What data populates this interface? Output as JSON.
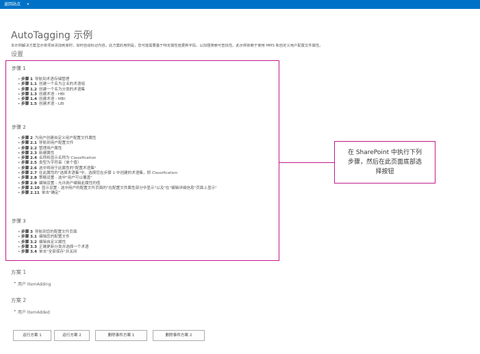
{
  "topbar": {
    "back_link": "返回站点",
    "caret": "▸"
  },
  "page": {
    "title": "AutoTagging 示例",
    "description": "本示例解决方案显示将项目添加到库时，如何自动标记内容。此方案的用例是，您可能需要基于特定属性值更新字段，以加强搜索可查找性。此示例依赖于使用 MMS 和自定义用户配置文件属性。",
    "settings_heading": "设置"
  },
  "steps": [
    {
      "title": "步骤 1",
      "items": [
        {
          "label": "步骤",
          "num": "1",
          "text": "导航到术语存储管理"
        },
        {
          "label": "步骤",
          "num": "1.1",
          "text": "创建一个名为企业的术语组"
        },
        {
          "label": "步骤",
          "num": "1.2",
          "text": "创建一个名为分类的术语集"
        },
        {
          "label": "步骤",
          "num": "1.3",
          "text": "创建术语 - HBI"
        },
        {
          "label": "步骤",
          "num": "1.4",
          "text": "创建术语 - MBI"
        },
        {
          "label": "步骤",
          "num": "1.5",
          "text": "创建术语 - LBI"
        }
      ]
    },
    {
      "title": "步骤 2",
      "items": [
        {
          "label": "步骤",
          "num": "2",
          "text": "为用户创建自定义用户配置文件属性"
        },
        {
          "label": "步骤",
          "num": "2.1",
          "text": "导航到用户配置文件"
        },
        {
          "label": "步骤",
          "num": "2.2",
          "text": "管理用户属性"
        },
        {
          "label": "步骤",
          "num": "2.3",
          "text": "新建属性"
        },
        {
          "label": "步骤",
          "num": "2.4",
          "text": "名称和显示名称为 Classification"
        },
        {
          "label": "步骤",
          "num": "2.5",
          "text": "类型为字符串（单个值）"
        },
        {
          "label": "步骤",
          "num": "2.6",
          "text": "选中将用于此属性的\"配置术语集\""
        },
        {
          "label": "步骤",
          "num": "2.7",
          "text": "在此属性的\"选择术语集\"中，选择您在步骤 1 中创建的术语集，即 Classification"
        },
        {
          "label": "步骤",
          "num": "2.8",
          "text": "策略设置 - 选中\"用户可以覆盖\""
        },
        {
          "label": "步骤",
          "num": "2.9",
          "text": "编辑设置 - 允许用户编辑此属性的值"
        },
        {
          "label": "步骤",
          "num": "2.10",
          "text": "显示设置 - 选中用户的配置文件页面的\"在配置文件属性部分中显示\"以及\"在\"编辑详细信息\"页面上显示\""
        },
        {
          "label": "步骤",
          "num": "2.11",
          "text": "单击\"确定\""
        }
      ]
    },
    {
      "title": "步骤 3",
      "items": [
        {
          "label": "步骤",
          "num": "3",
          "text": "导航到您的配置文件页面"
        },
        {
          "label": "步骤",
          "num": "3.1",
          "text": "编辑您的配置文件"
        },
        {
          "label": "步骤",
          "num": "3.2",
          "text": "编辑自定义属性"
        },
        {
          "label": "步骤",
          "num": "3.3",
          "text": "正确更新分类并选择一个术语"
        },
        {
          "label": "步骤",
          "num": "3.4",
          "text": "单击\"全部保存\"并关闭"
        }
      ]
    }
  ],
  "callout": {
    "text": "在 SharePoint 中执行下列步骤，然后在此页面底部选择按钮",
    "border_color": "#c0198a"
  },
  "scenarios": [
    {
      "title": "方案 1",
      "item": "用户 ItemAdding"
    },
    {
      "title": "方案 2",
      "item": "用户 ItemAdded"
    }
  ],
  "buttons": {
    "run_scenario_1": "运行方案 1",
    "run_scenario_2": "运行方案 2",
    "remove_event_1": "删除事件方案 1",
    "remove_event_2": "删除事件方案 2"
  },
  "colors": {
    "topbar": "#0072c6",
    "highlight": "#c0198a"
  }
}
